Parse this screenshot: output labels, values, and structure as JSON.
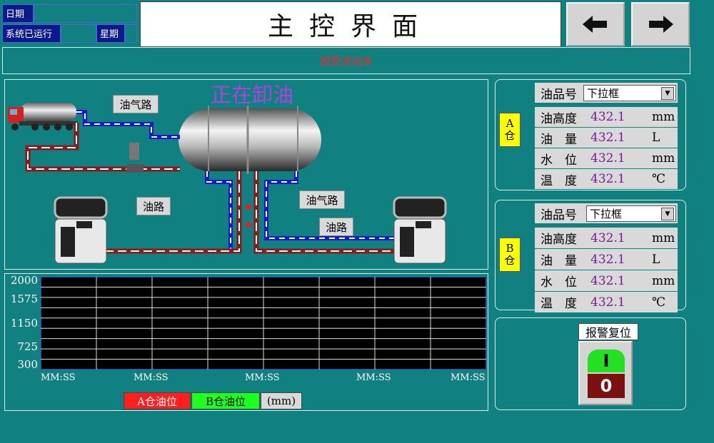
{
  "header": {
    "date_label": "日期",
    "runtime_label": "系统已运行",
    "weekday_label": "星期",
    "title": "主控界面",
    "back_icon": "arrow-left-icon",
    "forward_icon": "arrow-right-icon"
  },
  "alarm_bar": {
    "text": "报警滚动条"
  },
  "process": {
    "status_text": "正在卸油",
    "labels": {
      "oil_gas_1": "油气路",
      "oil_1": "油路",
      "oil_gas_2": "油气路",
      "oil_2": "油路"
    },
    "colors": {
      "oil_line": "#8b1a1a",
      "gas_line": "#1a1acc"
    }
  },
  "bin_a": {
    "tag_line1": "A",
    "tag_line2": "仓",
    "product_label": "油品号",
    "product_select": "下拉框",
    "rows": [
      {
        "key": "油高度",
        "value": "432.1",
        "unit": "mm"
      },
      {
        "key": "油　量",
        "value": "432.1",
        "unit": "L"
      },
      {
        "key": "水　位",
        "value": "432.1",
        "unit": "mm"
      },
      {
        "key": "温　度",
        "value": "432.1",
        "unit": "℃"
      }
    ]
  },
  "bin_b": {
    "tag_line1": "B",
    "tag_line2": "仓",
    "product_label": "油品号",
    "product_select": "下拉框",
    "rows": [
      {
        "key": "油高度",
        "value": "432.1",
        "unit": "mm"
      },
      {
        "key": "油　量",
        "value": "432.1",
        "unit": "L"
      },
      {
        "key": "水　位",
        "value": "432.1",
        "unit": "mm"
      },
      {
        "key": "温　度",
        "value": "432.1",
        "unit": "℃"
      }
    ]
  },
  "chart": {
    "y_ticks": [
      "2000",
      "1575",
      "1150",
      "725",
      "300"
    ],
    "x_ticks": [
      "MM:SS",
      "MM:SS",
      "MM:SS",
      "MM:SS",
      "MM:SS"
    ],
    "legend": {
      "a": "A仓油位",
      "b": "B仓油位",
      "unit": "(mm)"
    },
    "colors": {
      "a": "#ff1f1f",
      "b": "#1fff1f"
    }
  },
  "chart_data": {
    "type": "line",
    "x": [
      "MM:SS",
      "MM:SS",
      "MM:SS",
      "MM:SS",
      "MM:SS"
    ],
    "ylim": [
      300,
      2000
    ],
    "grid": true,
    "series": [
      {
        "name": "A仓油位",
        "values": []
      },
      {
        "name": "B仓油位",
        "values": []
      }
    ],
    "ylabel": "(mm)"
  },
  "reset": {
    "label": "报警复位",
    "on_text": "I",
    "off_text": "0"
  }
}
